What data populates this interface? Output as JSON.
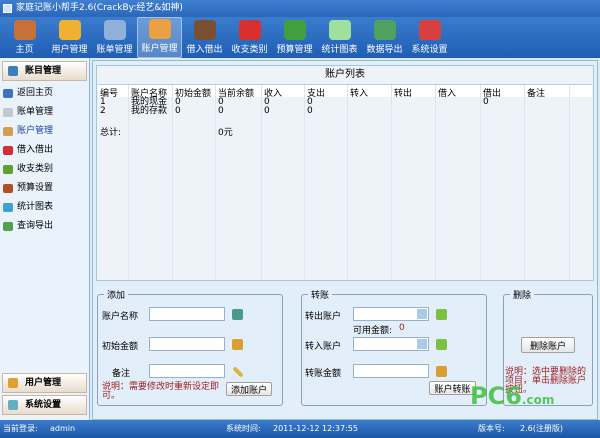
{
  "title": "家庭记账小帮手2.6(CrackBy:经艺&如神)",
  "toolbar": [
    {
      "label": "主页",
      "color": "#c8703a"
    },
    {
      "label": "用户管理",
      "color": "#f0b030"
    },
    {
      "label": "账单管理",
      "color": "#8fb0d8"
    },
    {
      "label": "账户管理",
      "color": "#e8a040",
      "active": true
    },
    {
      "label": "借入借出",
      "color": "#7a5030"
    },
    {
      "label": "收支类别",
      "color": "#d83030"
    },
    {
      "label": "预算管理",
      "color": "#40a040"
    },
    {
      "label": "统计图表",
      "color": "#9fe09f"
    },
    {
      "label": "数据导出",
      "color": "#50a060"
    },
    {
      "label": "系统设置",
      "color": "#d84040"
    }
  ],
  "sidebar": {
    "header": "账目管理",
    "items": [
      {
        "label": "返回主页",
        "color": "#4070c0"
      },
      {
        "label": "账单管理",
        "color": "#c0c8d0"
      },
      {
        "label": "账户管理",
        "color": "#d0a050",
        "active": true
      },
      {
        "label": "借入借出",
        "color": "#d03030"
      },
      {
        "label": "收支类别",
        "color": "#60a030"
      },
      {
        "label": "预算设置",
        "color": "#b05020"
      },
      {
        "label": "统计图表",
        "color": "#40a0d0"
      },
      {
        "label": "查询导出",
        "color": "#50a050"
      }
    ],
    "bottom": [
      {
        "label": "用户管理"
      },
      {
        "label": "系统设置"
      }
    ]
  },
  "table": {
    "title": "账户列表",
    "columns": [
      "编号",
      "账户名称",
      "初始金额",
      "当前余额",
      "收入",
      "支出",
      "转入",
      "转出",
      "借入",
      "借出",
      "备注"
    ],
    "rows": [
      [
        "1",
        "我的现金",
        "0",
        "0",
        "0",
        "0",
        "",
        "",
        "",
        "0",
        ""
      ],
      [
        "2",
        "我的存款",
        "0",
        "0",
        "0",
        "0",
        "",
        "",
        "",
        "",
        ""
      ]
    ],
    "total_label": "总计:",
    "total_value": "0元"
  },
  "add": {
    "title": "添加",
    "name_label": "账户名称",
    "amount_label": "初始金额",
    "note_label": "备注",
    "name_value": "",
    "amount_value": "",
    "note_value": "",
    "note": "说明：需要修改时重新设定即可。",
    "button": "添加账户"
  },
  "transfer": {
    "title": "转账",
    "from_label": "转出账户",
    "available_label": "可用金额:",
    "available_value": "0",
    "to_label": "转入账户",
    "amount_label": "转账金额",
    "button": "账户转账"
  },
  "delete": {
    "title": "删除",
    "button": "删除账户",
    "note": "说明：选中要删除的项目，单击删除账户按钮。"
  },
  "status": {
    "login_label": "当前登录:",
    "login_value": "admin",
    "time_label": "系统时间:",
    "time_value": "2011-12-12 12:37:55",
    "version_label": "版本号:",
    "version_value": "2.6(注册版)"
  },
  "watermark": "PC6.com 下载"
}
